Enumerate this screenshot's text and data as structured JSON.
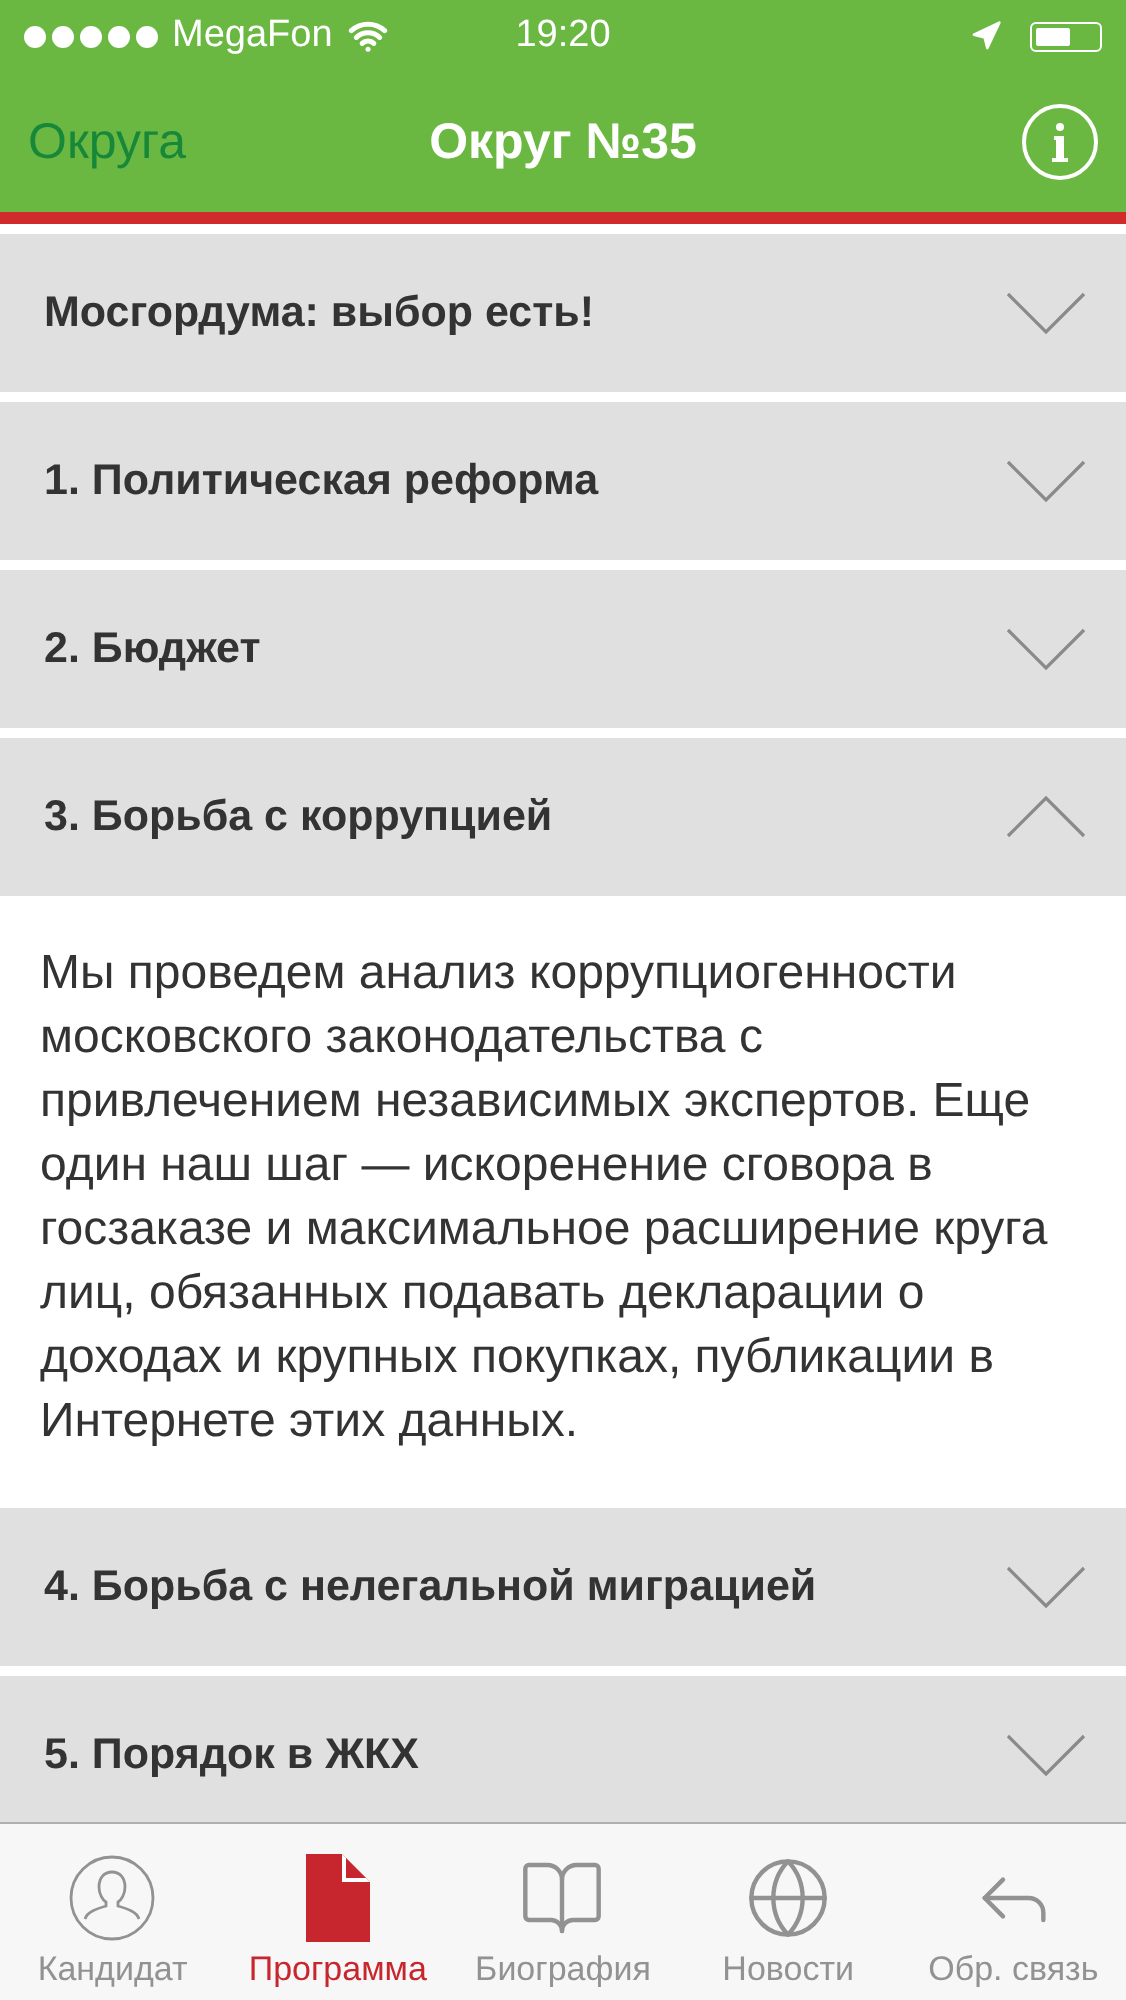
{
  "status_bar": {
    "carrier": "MegaFon",
    "time": "19:20"
  },
  "nav": {
    "back": "Округа",
    "title": "Округ №35"
  },
  "sections": [
    {
      "title": "Мосгордума: выбор есть!",
      "expanded": false
    },
    {
      "title": "1. Политическая реформа",
      "expanded": false
    },
    {
      "title": "2. Бюджет",
      "expanded": false
    },
    {
      "title": "3. Борьба с коррупцией",
      "expanded": true,
      "body": "Мы проведем анализ коррупциогенности московского законодательства с привлечением независимых экспертов. Еще один наш шаг — искоренение сговора в госзаказе и максимальное расширение круга лиц, обязанных подавать декларации о доходах и крупных покупках, публикации в Интернете этих данных."
    },
    {
      "title": "4. Борьба с нелегальной миграцией",
      "expanded": false
    },
    {
      "title": "5. Порядок в ЖКХ",
      "expanded": false
    }
  ],
  "tabs": [
    {
      "label": "Кандидат",
      "selected": false
    },
    {
      "label": "Программа",
      "selected": true
    },
    {
      "label": "Биография",
      "selected": false
    },
    {
      "label": "Новости",
      "selected": false
    },
    {
      "label": "Обр. связь",
      "selected": false
    }
  ]
}
